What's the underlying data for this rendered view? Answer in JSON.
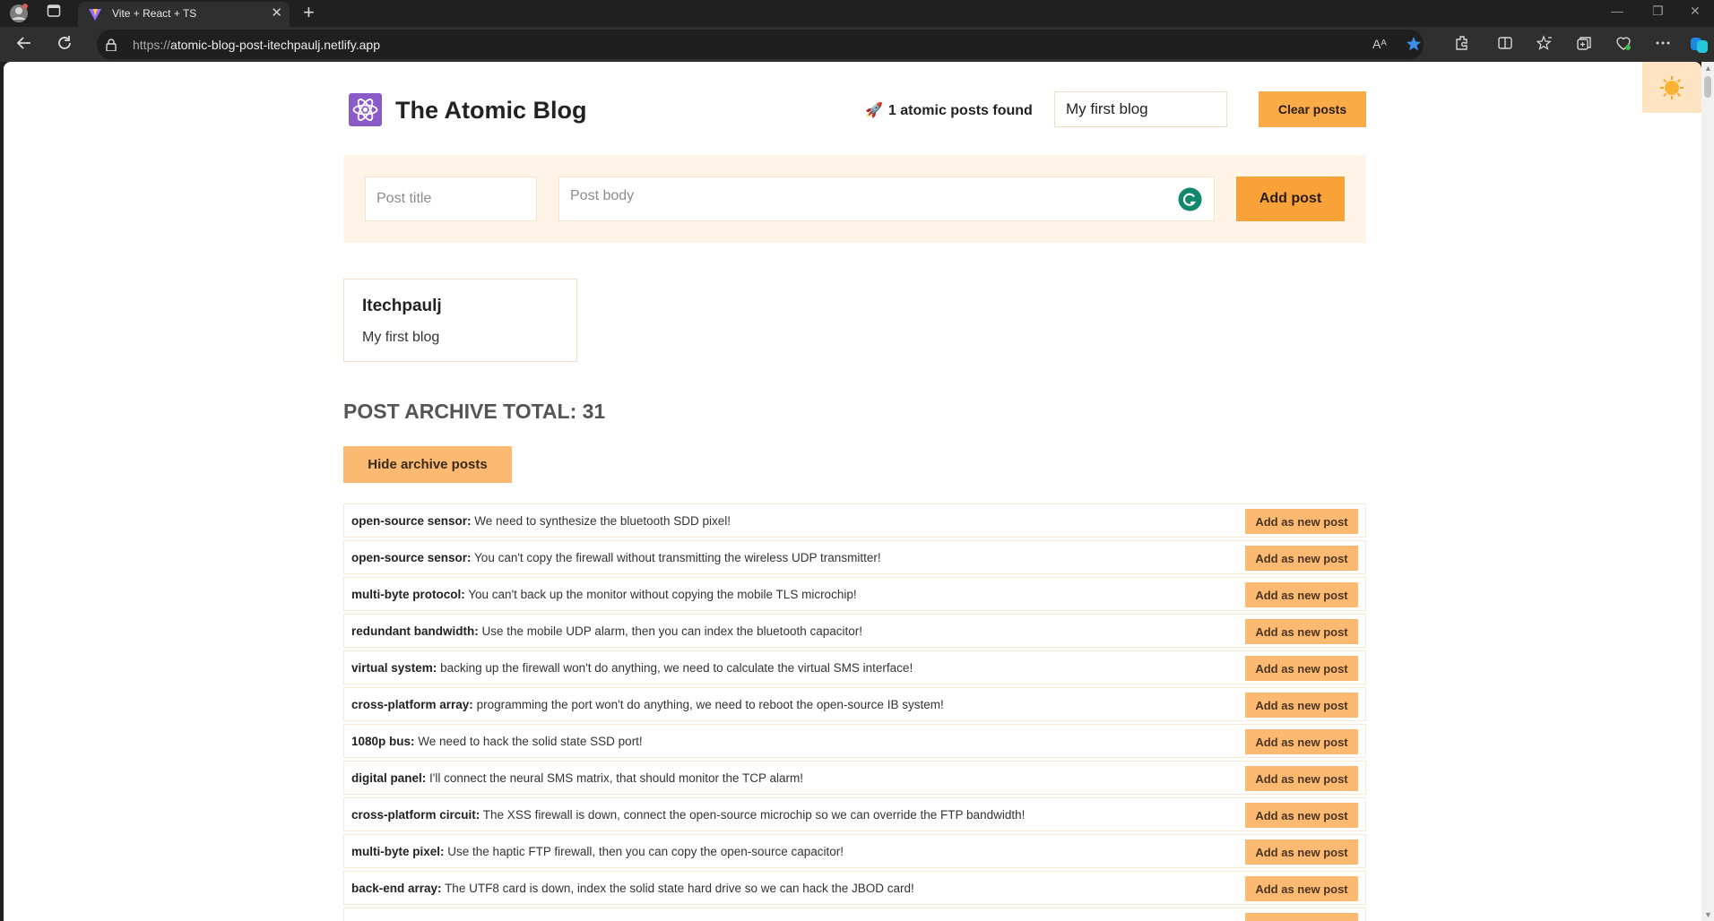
{
  "browser": {
    "tab_title": "Vite + React + TS",
    "url_protocol": "https://",
    "url_host": "atomic-blog-post-itechpaulj.netlify.app",
    "tab_close_glyph": "✕",
    "new_tab_glyph": "+",
    "read_aloud_label": "Aᴬ",
    "window_controls": [
      "—",
      "❐",
      "✕"
    ],
    "icons": [
      "profile-avatar-icon",
      "tab-actions-icon",
      "back-icon",
      "refresh-icon",
      "lock-icon",
      "read-aloud-icon",
      "favorite-star-icon",
      "extensions-icon",
      "split-screen-icon",
      "favorites-icon",
      "collections-icon",
      "browser-essentials-icon",
      "more-menu-icon",
      "copilot-icon"
    ],
    "colors": {
      "chrome_dark": "#202020",
      "chrome_bar": "#2f2f2f",
      "star": "#3b8eea"
    }
  },
  "header": {
    "title": "The Atomic Blog",
    "found_icon": "🚀",
    "found_text": "1 atomic posts found",
    "search_value": "My first blog",
    "clear_label": "Clear posts"
  },
  "form": {
    "title_placeholder": "Post title",
    "body_placeholder": "Post body",
    "add_label": "Add post"
  },
  "posts": [
    {
      "title": "Itechpaulj",
      "body": "My first blog"
    }
  ],
  "archive": {
    "heading": "POST ARCHIVE TOTAL: 31",
    "hide_label": "Hide archive posts",
    "row_button_label": "Add as new post",
    "items": [
      {
        "title": "open-source sensor:",
        "body": "We need to synthesize the bluetooth SDD pixel!"
      },
      {
        "title": "open-source sensor:",
        "body": "You can't copy the firewall without transmitting the wireless UDP transmitter!"
      },
      {
        "title": "multi-byte protocol:",
        "body": "You can't back up the monitor without copying the mobile TLS microchip!"
      },
      {
        "title": "redundant bandwidth:",
        "body": "Use the mobile UDP alarm, then you can index the bluetooth capacitor!"
      },
      {
        "title": "virtual system:",
        "body": "backing up the firewall won't do anything, we need to calculate the virtual SMS interface!"
      },
      {
        "title": "cross-platform array:",
        "body": "programming the port won't do anything, we need to reboot the open-source IB system!"
      },
      {
        "title": "1080p bus:",
        "body": "We need to hack the solid state SSD port!"
      },
      {
        "title": "digital panel:",
        "body": "I'll connect the neural SMS matrix, that should monitor the TCP alarm!"
      },
      {
        "title": "cross-platform circuit:",
        "body": "The XSS firewall is down, connect the open-source microchip so we can override the FTP bandwidth!"
      },
      {
        "title": "multi-byte pixel:",
        "body": "Use the haptic FTP firewall, then you can copy the open-source capacitor!"
      },
      {
        "title": "back-end array:",
        "body": "The UTF8 card is down, index the solid state hard drive so we can hack the JBOD card!"
      }
    ]
  },
  "theme": {
    "icon": "sun-icon",
    "accent": "#f9ab48",
    "form_bg": "#fff4e6",
    "toggle_bg": "#ffe4c4"
  }
}
